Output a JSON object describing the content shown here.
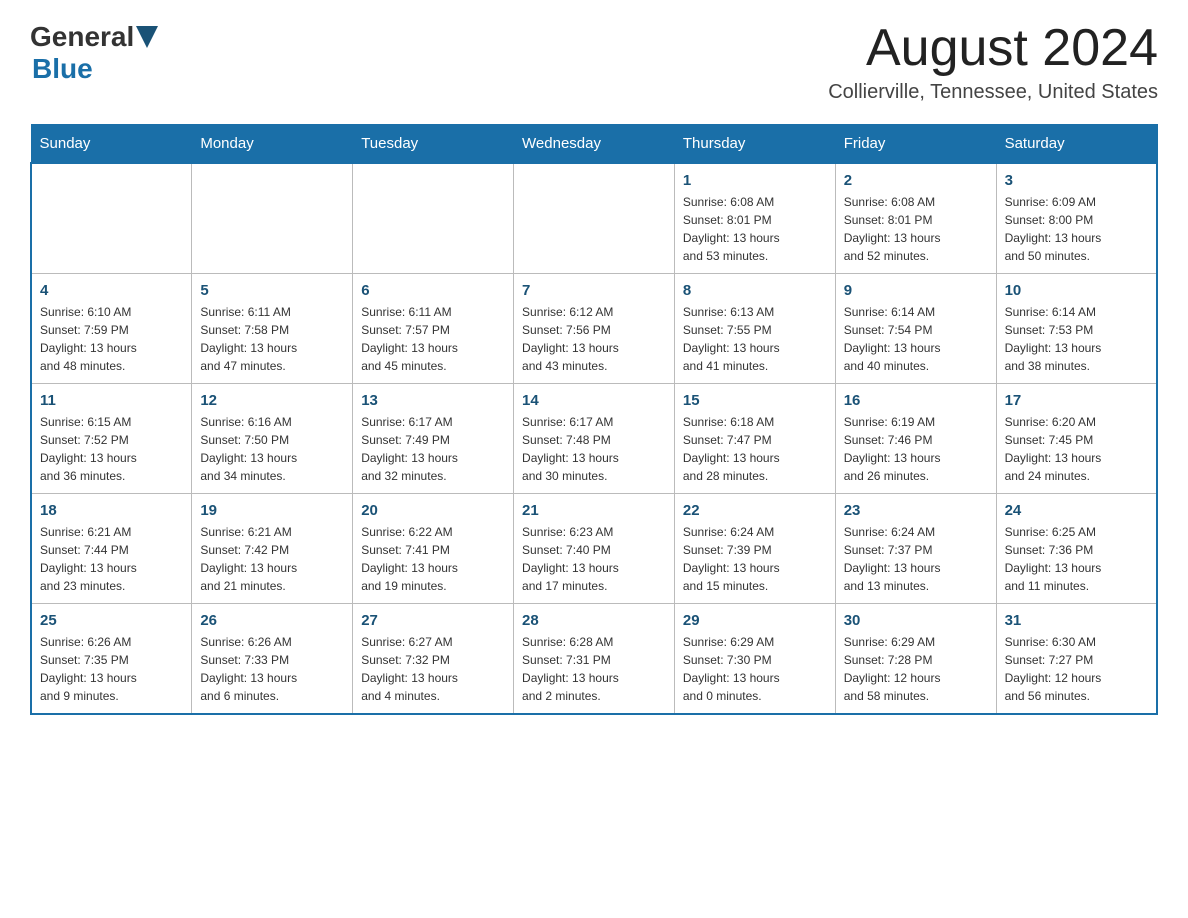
{
  "header": {
    "logo_general": "General",
    "logo_blue": "Blue",
    "month_title": "August 2024",
    "location": "Collierville, Tennessee, United States"
  },
  "calendar": {
    "days_of_week": [
      "Sunday",
      "Monday",
      "Tuesday",
      "Wednesday",
      "Thursday",
      "Friday",
      "Saturday"
    ],
    "weeks": [
      [
        {
          "day": "",
          "info": ""
        },
        {
          "day": "",
          "info": ""
        },
        {
          "day": "",
          "info": ""
        },
        {
          "day": "",
          "info": ""
        },
        {
          "day": "1",
          "info": "Sunrise: 6:08 AM\nSunset: 8:01 PM\nDaylight: 13 hours\nand 53 minutes."
        },
        {
          "day": "2",
          "info": "Sunrise: 6:08 AM\nSunset: 8:01 PM\nDaylight: 13 hours\nand 52 minutes."
        },
        {
          "day": "3",
          "info": "Sunrise: 6:09 AM\nSunset: 8:00 PM\nDaylight: 13 hours\nand 50 minutes."
        }
      ],
      [
        {
          "day": "4",
          "info": "Sunrise: 6:10 AM\nSunset: 7:59 PM\nDaylight: 13 hours\nand 48 minutes."
        },
        {
          "day": "5",
          "info": "Sunrise: 6:11 AM\nSunset: 7:58 PM\nDaylight: 13 hours\nand 47 minutes."
        },
        {
          "day": "6",
          "info": "Sunrise: 6:11 AM\nSunset: 7:57 PM\nDaylight: 13 hours\nand 45 minutes."
        },
        {
          "day": "7",
          "info": "Sunrise: 6:12 AM\nSunset: 7:56 PM\nDaylight: 13 hours\nand 43 minutes."
        },
        {
          "day": "8",
          "info": "Sunrise: 6:13 AM\nSunset: 7:55 PM\nDaylight: 13 hours\nand 41 minutes."
        },
        {
          "day": "9",
          "info": "Sunrise: 6:14 AM\nSunset: 7:54 PM\nDaylight: 13 hours\nand 40 minutes."
        },
        {
          "day": "10",
          "info": "Sunrise: 6:14 AM\nSunset: 7:53 PM\nDaylight: 13 hours\nand 38 minutes."
        }
      ],
      [
        {
          "day": "11",
          "info": "Sunrise: 6:15 AM\nSunset: 7:52 PM\nDaylight: 13 hours\nand 36 minutes."
        },
        {
          "day": "12",
          "info": "Sunrise: 6:16 AM\nSunset: 7:50 PM\nDaylight: 13 hours\nand 34 minutes."
        },
        {
          "day": "13",
          "info": "Sunrise: 6:17 AM\nSunset: 7:49 PM\nDaylight: 13 hours\nand 32 minutes."
        },
        {
          "day": "14",
          "info": "Sunrise: 6:17 AM\nSunset: 7:48 PM\nDaylight: 13 hours\nand 30 minutes."
        },
        {
          "day": "15",
          "info": "Sunrise: 6:18 AM\nSunset: 7:47 PM\nDaylight: 13 hours\nand 28 minutes."
        },
        {
          "day": "16",
          "info": "Sunrise: 6:19 AM\nSunset: 7:46 PM\nDaylight: 13 hours\nand 26 minutes."
        },
        {
          "day": "17",
          "info": "Sunrise: 6:20 AM\nSunset: 7:45 PM\nDaylight: 13 hours\nand 24 minutes."
        }
      ],
      [
        {
          "day": "18",
          "info": "Sunrise: 6:21 AM\nSunset: 7:44 PM\nDaylight: 13 hours\nand 23 minutes."
        },
        {
          "day": "19",
          "info": "Sunrise: 6:21 AM\nSunset: 7:42 PM\nDaylight: 13 hours\nand 21 minutes."
        },
        {
          "day": "20",
          "info": "Sunrise: 6:22 AM\nSunset: 7:41 PM\nDaylight: 13 hours\nand 19 minutes."
        },
        {
          "day": "21",
          "info": "Sunrise: 6:23 AM\nSunset: 7:40 PM\nDaylight: 13 hours\nand 17 minutes."
        },
        {
          "day": "22",
          "info": "Sunrise: 6:24 AM\nSunset: 7:39 PM\nDaylight: 13 hours\nand 15 minutes."
        },
        {
          "day": "23",
          "info": "Sunrise: 6:24 AM\nSunset: 7:37 PM\nDaylight: 13 hours\nand 13 minutes."
        },
        {
          "day": "24",
          "info": "Sunrise: 6:25 AM\nSunset: 7:36 PM\nDaylight: 13 hours\nand 11 minutes."
        }
      ],
      [
        {
          "day": "25",
          "info": "Sunrise: 6:26 AM\nSunset: 7:35 PM\nDaylight: 13 hours\nand 9 minutes."
        },
        {
          "day": "26",
          "info": "Sunrise: 6:26 AM\nSunset: 7:33 PM\nDaylight: 13 hours\nand 6 minutes."
        },
        {
          "day": "27",
          "info": "Sunrise: 6:27 AM\nSunset: 7:32 PM\nDaylight: 13 hours\nand 4 minutes."
        },
        {
          "day": "28",
          "info": "Sunrise: 6:28 AM\nSunset: 7:31 PM\nDaylight: 13 hours\nand 2 minutes."
        },
        {
          "day": "29",
          "info": "Sunrise: 6:29 AM\nSunset: 7:30 PM\nDaylight: 13 hours\nand 0 minutes."
        },
        {
          "day": "30",
          "info": "Sunrise: 6:29 AM\nSunset: 7:28 PM\nDaylight: 12 hours\nand 58 minutes."
        },
        {
          "day": "31",
          "info": "Sunrise: 6:30 AM\nSunset: 7:27 PM\nDaylight: 12 hours\nand 56 minutes."
        }
      ]
    ]
  }
}
